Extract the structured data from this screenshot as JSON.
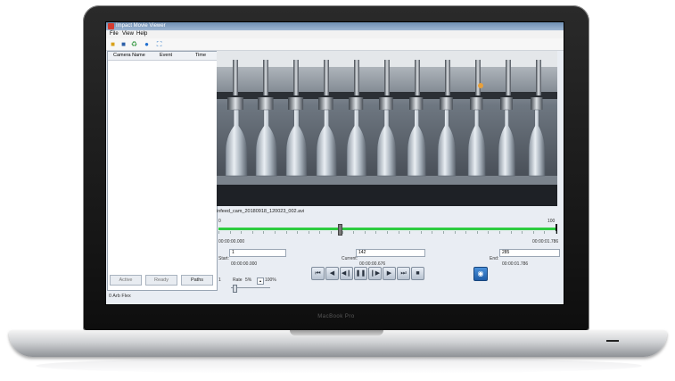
{
  "laptop": {
    "brand": "MacBook Pro"
  },
  "app": {
    "title": "Impact Movie Viewer",
    "menu": [
      "File",
      "View",
      "Help"
    ],
    "toolbar_icons": [
      "open-folder-icon",
      "save-icon",
      "recycle-icon",
      "info-icon",
      "fullscreen-icon"
    ],
    "left_panel": {
      "columns": [
        "Camera Name",
        "Event",
        "Time"
      ],
      "buttons": {
        "active": "Active",
        "ready": "Ready",
        "paths": "Paths"
      },
      "status": "0 Arb Flex"
    },
    "video": {
      "filename": "infeed_cam_20180918_120023_002.avi",
      "seek_start": "0",
      "seek_end": "100",
      "seek_position": 0.36
    },
    "times": {
      "current_left": "00:00:00.000",
      "total_right": "00:00:01.786"
    },
    "start": {
      "label": "Start:",
      "frame": "1",
      "time": "00:00:00.000"
    },
    "current": {
      "label": "Current:",
      "frame": "142",
      "time": "00:00:00.676"
    },
    "end": {
      "label": "End:",
      "frame": "285",
      "time": "00:00:01.786"
    },
    "rate": {
      "step": "1",
      "label": "Rate",
      "value": "5%",
      "max": "100%"
    },
    "transport": [
      "skip-start-icon",
      "prev-icon",
      "step-back-icon",
      "pause-icon",
      "step-forward-icon",
      "play-icon",
      "skip-end-icon",
      "stop-icon"
    ],
    "media_button_icon": "media-icon"
  }
}
